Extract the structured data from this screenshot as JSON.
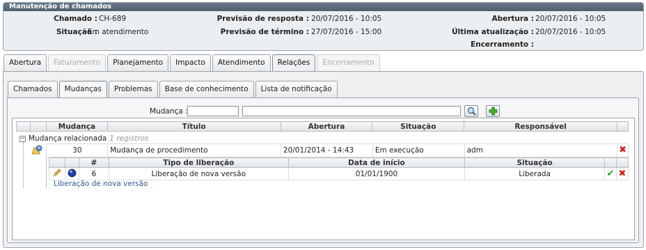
{
  "header": {
    "title": "Manutenção de chamados",
    "chamado_label": "Chamado :",
    "chamado_value": "CH-689",
    "situacao_label": "Situação :",
    "situacao_value": "Em atendimento",
    "prev_resposta_label": "Previsão de resposta :",
    "prev_resposta_value": "20/07/2016 - 10:05",
    "prev_termino_label": "Previsão de término :",
    "prev_termino_value": "27/07/2016 - 15:00",
    "abertura_label": "Abertura :",
    "abertura_value": "20/07/2016 - 10:05",
    "ultima_label": "Última atualização :",
    "ultima_value": "20/07/2016 - 10:05",
    "encerramento_label": "Encerramento :",
    "encerramento_value": ""
  },
  "tabs": [
    {
      "label": "Abertura",
      "state": "normal"
    },
    {
      "label": "Faturamento",
      "state": "disabled"
    },
    {
      "label": "Planejamento",
      "state": "normal"
    },
    {
      "label": "Impacto",
      "state": "normal"
    },
    {
      "label": "Atendimento",
      "state": "normal"
    },
    {
      "label": "Relações",
      "state": "active"
    },
    {
      "label": "Encerramento",
      "state": "disabled"
    }
  ],
  "subtabs": [
    {
      "label": "Chamados",
      "state": "normal"
    },
    {
      "label": "Mudanças",
      "state": "active"
    },
    {
      "label": "Problemas",
      "state": "normal"
    },
    {
      "label": "Base de conhecimento",
      "state": "normal"
    },
    {
      "label": "Lista de notificação",
      "state": "normal"
    }
  ],
  "search": {
    "label": "Mudança :",
    "code_value": "",
    "desc_value": "",
    "search_icon": "magnifier-icon",
    "add_icon": "plus-icon"
  },
  "grid": {
    "columns": [
      "Mudança",
      "Título",
      "Abertura",
      "Situação",
      "Responsável"
    ],
    "group_label": "Mudança relacionada",
    "group_count": "1 registros",
    "rows": [
      {
        "mudanca": "30",
        "titulo": "Mudança de procedimento",
        "abertura": "20/01/2014 - 14:43",
        "situacao": "Em execução",
        "responsavel": "adm"
      }
    ]
  },
  "subgrid": {
    "columns": [
      "#",
      "Tipo de liberação",
      "Data de início",
      "Situação"
    ],
    "rows": [
      {
        "num": "6",
        "tipo": "Liberação de nova versão",
        "data": "01/01/1900",
        "situacao": "Liberada"
      }
    ],
    "link": "Liberação de nova versão"
  },
  "colors": {
    "header_bar": "#5a6978",
    "delete": "#d42020",
    "approve": "#2d9b20",
    "link": "#2b5a94"
  }
}
